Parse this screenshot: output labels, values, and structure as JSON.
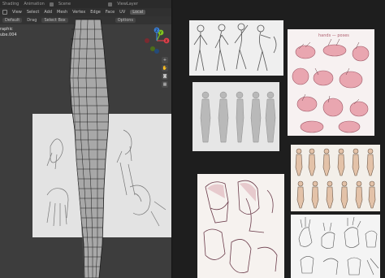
{
  "blender": {
    "topbar": {
      "tab_shading": "Shading",
      "tab_animation": "Animation",
      "scene_label": "Scene",
      "viewlayer_label": "ViewLayer"
    },
    "menubar": {
      "view": "View",
      "select": "Select",
      "add": "Add",
      "mesh": "Mesh",
      "vertex": "Vertex",
      "edge": "Edge",
      "face": "Face",
      "uv": "UV",
      "transform": "Local"
    },
    "toolbar": {
      "orientation": "Default",
      "drag": "Drag",
      "select_box": "Select Box",
      "options": "Options"
    },
    "viewport": {
      "view_name": "raphic",
      "object_name": "ube.004"
    },
    "gizmo": {
      "x": "X",
      "y": "Y",
      "z": "Z"
    },
    "colors": {
      "x_axis": "#e0404a",
      "y_axis": "#7ec321",
      "z_axis": "#3a7fd6",
      "wire": "#1a1a1a",
      "mesh": "#a6a6a6"
    }
  },
  "board": {
    "references": [
      {
        "id": "figure-sketches",
        "kind": "sketch"
      },
      {
        "id": "hand-studies-pink",
        "kind": "color-sketch",
        "title": "hands — poses"
      },
      {
        "id": "turnaround",
        "kind": "turnaround"
      },
      {
        "id": "torso-studies",
        "kind": "sketch"
      },
      {
        "id": "body-poses",
        "kind": "sketch"
      },
      {
        "id": "hand-gestures",
        "kind": "sketch"
      }
    ]
  }
}
